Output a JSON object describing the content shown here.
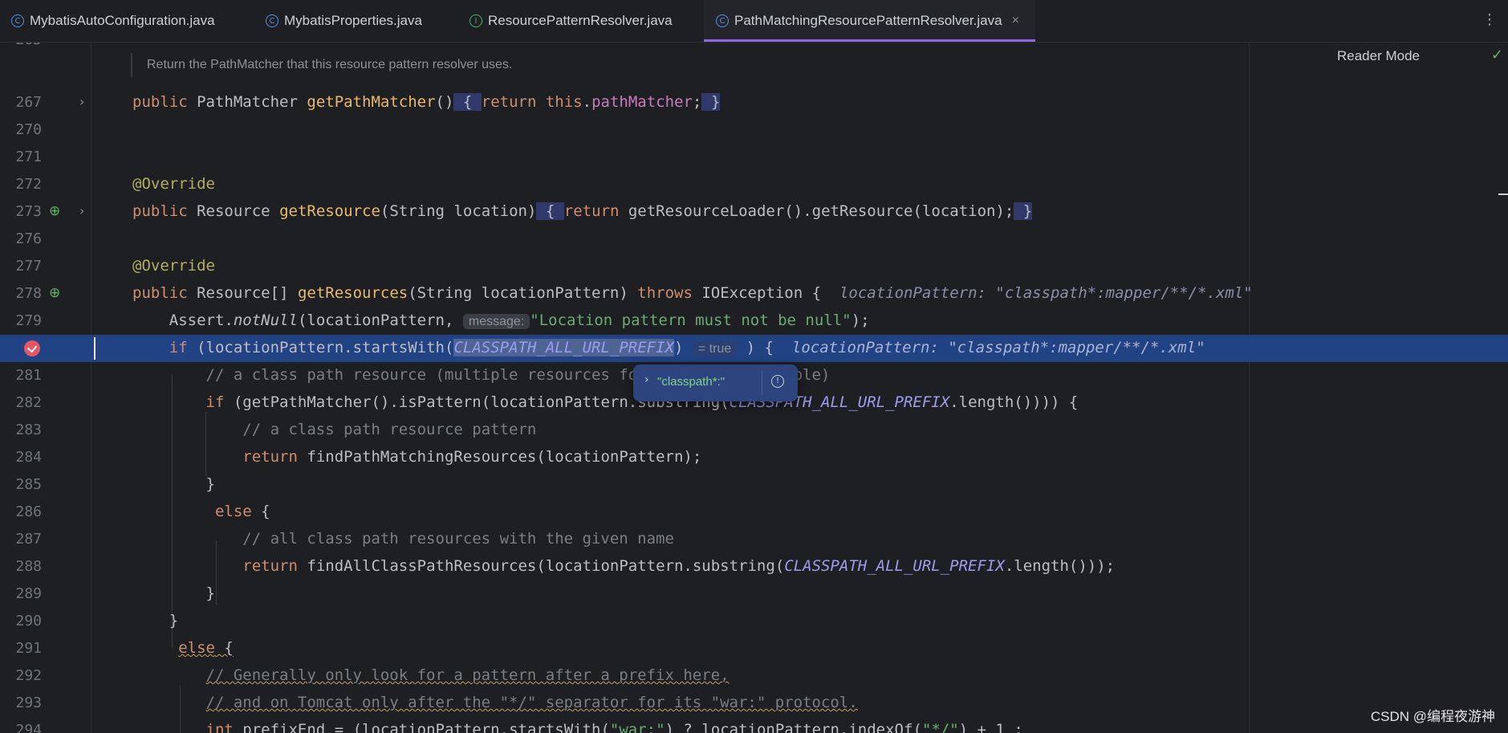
{
  "tabs": [
    {
      "label": "MybatisAutoConfiguration.java",
      "icon": "class-icon"
    },
    {
      "label": "MybatisProperties.java",
      "icon": "class-icon"
    },
    {
      "label": "ResourcePatternResolver.java",
      "icon": "interface-icon"
    },
    {
      "label": "PathMatchingResourcePatternResolver.java",
      "icon": "class-icon",
      "active": true
    }
  ],
  "tab_icons": {
    "class": "C",
    "interface": "I",
    "close": "×",
    "more": "⋮"
  },
  "doc_comment": "Return the PathMatcher that this resource pattern resolver uses.",
  "reader_mode": "Reader Mode",
  "top_partial_line": "265",
  "lines": {
    "l267": "267",
    "l270": "270",
    "l271": "271",
    "l272": "272",
    "l273": "273",
    "l276": "276",
    "l277": "277",
    "l278": "278",
    "l279": "279",
    "l281": "281",
    "l282": "282",
    "l283": "283",
    "l284": "284",
    "l285": "285",
    "l286": "286",
    "l287": "287",
    "l288": "288",
    "l289": "289",
    "l290": "290",
    "l291": "291",
    "l292": "292",
    "l293": "293",
    "l294": "294"
  },
  "code": {
    "public": "public",
    "PathMatcher": "PathMatcher",
    "getPathMatcher": "getPathMatcher",
    "return": "return",
    "this": "this",
    "pathMatcher": "pathMatcher",
    "override": "@Override",
    "Resource": "Resource",
    "getResource": "getResource",
    "String": "String",
    "location": "location",
    "getResourceLoader": "getResourceLoader",
    "ResourceArr": "Resource[]",
    "getResources": "getResources",
    "locationPattern": "locationPattern",
    "throws": "throws",
    "IOException": "IOException",
    "Assert": "Assert",
    "notNull": "notNull",
    "message_hint": "message:",
    "assert_msg": "\"Location pattern must not be null\"",
    "if": "if",
    "startsWith": "startsWith",
    "CLASSPATH_ALL_URL_PREFIX": "CLASSPATH_ALL_URL_PREFIX",
    "true_hint": "= true",
    "inline_value": "locationPattern: \"classpath*:mapper/**/*.xml\"",
    "c281": "// a class path resource (multiple resources for same name possible)",
    "getPathMatcher2": "getPathMatcher",
    "isPattern": "isPattern",
    "substring": "substring",
    "length": "length",
    "c283": "// a class path resource pattern",
    "findPathMatchingResources": "findPathMatchingResources",
    "else": "else",
    "c287": "// all class path resources with the given name",
    "findAllClassPathResources": "findAllClassPathResources",
    "c292": "// Generally only look for a pattern after a prefix here,",
    "c293": "// and on Tomcat only after the \"*/\" separator for its \"war:\" protocol.",
    "int": "int",
    "prefixEnd": "prefixEnd",
    "war": "\"war:\"",
    "indexOf": "indexOf",
    "starslash": "\"*/\"",
    "one": "1"
  },
  "debug_popup": {
    "value": "\"classpath*:\"",
    "expand_icon": "›",
    "info_icon": "!"
  },
  "watermark": "CSDN @编程夜游神",
  "colors": {
    "accent": "#9067e8",
    "current_line": "#214283",
    "breakpoint": "#e55765",
    "popup": "#2e447e"
  }
}
